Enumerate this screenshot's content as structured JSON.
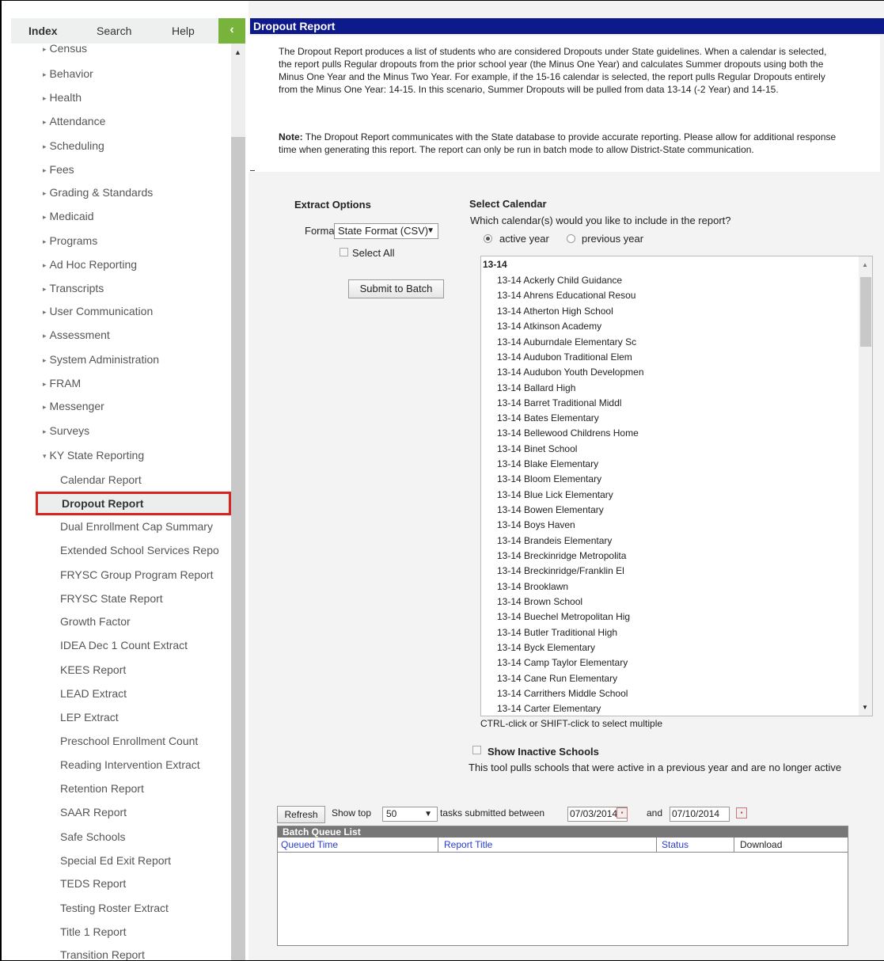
{
  "sidebar": {
    "tabs": {
      "index": "Index",
      "search": "Search",
      "help": "Help",
      "collapse": "‹"
    },
    "items": [
      "Census",
      "Behavior",
      "Health",
      "Attendance",
      "Scheduling",
      "Fees",
      "Grading & Standards",
      "Medicaid",
      "Programs",
      "Ad Hoc Reporting",
      "Transcripts",
      "User Communication",
      "Assessment",
      "System Administration",
      "FRAM",
      "Messenger",
      "Surveys"
    ],
    "expanded": "KY State Reporting",
    "subitems": [
      "Calendar Report",
      "Dropout Report",
      "Dual Enrollment Cap Summary",
      "Extended School Services Repo",
      "FRYSC Group Program Report",
      "FRYSC State Report",
      "Growth Factor",
      "IDEA Dec 1 Count Extract",
      "KEES Report",
      "LEAD Extract",
      "LEP Extract",
      "Preschool Enrollment Count",
      "Reading Intervention Extract",
      "Retention Report",
      "SAAR Report",
      "Safe Schools",
      "Special Ed Exit Report",
      "TEDS Report",
      "Testing Roster Extract",
      "Title 1 Report",
      "Transition Report"
    ],
    "selected": "Dropout Report"
  },
  "header": {
    "title": "Dropout Report"
  },
  "description": {
    "p1": "The Dropout Report produces a list of students who are considered Dropouts under State guidelines. When a calendar is selected, the report pulls Regular dropouts from the prior school year (the Minus One Year) and calculates Summer dropouts using both the Minus One Year and the Minus Two Year. For example, if the 15-16 calendar is selected, the report pulls Regular Dropouts entirely from the Minus One Year: 14-15. In this scenario, Summer Dropouts will be pulled from data 13-14 (-2 Year) and 14-15.",
    "note_label": "Note:",
    "note": " The Dropout Report communicates with the State database to provide accurate reporting. Please allow for additional response time when generating this report. The report can only be run in batch mode to allow District-State communication."
  },
  "extract": {
    "title": "Extract Options",
    "format_label": "Format",
    "format_value": "State Format (CSV)",
    "select_all": "Select All",
    "submit": "Submit to Batch"
  },
  "calendar": {
    "title": "Select Calendar",
    "question": "Which calendar(s) would you like to include in the report?",
    "radio_active": "active year",
    "radio_previous": "previous year",
    "group": "13-14",
    "options": [
      "13-14 Ackerly Child Guidance",
      "13-14 Ahrens Educational Resou",
      "13-14 Atherton High School",
      "13-14 Atkinson Academy",
      "13-14 Auburndale Elementary Sc",
      "13-14 Audubon Traditional Elem",
      "13-14 Audubon Youth Developmen",
      "13-14 Ballard High",
      "13-14 Barret Traditional Middl",
      "13-14 Bates Elementary",
      "13-14 Bellewood Childrens Home",
      "13-14 Binet School",
      "13-14 Blake Elementary",
      "13-14 Bloom Elementary",
      "13-14 Blue Lick Elementary",
      "13-14 Bowen Elementary",
      "13-14 Boys Haven",
      "13-14 Brandeis Elementary",
      "13-14 Breckinridge Metropolita",
      "13-14 Breckinridge/Franklin El",
      "13-14 Brooklawn",
      "13-14 Brown School",
      "13-14 Buechel Metropolitan Hig",
      "13-14 Butler Traditional High",
      "13-14 Byck Elementary",
      "13-14 Camp Taylor Elementary",
      "13-14 Cane Run Elementary",
      "13-14 Carrithers Middle School",
      "13-14 Carter Elementary"
    ],
    "hint": "CTRL-click or SHIFT-click to select multiple",
    "inactive_label": "Show Inactive Schools",
    "inactive_note": "This tool pulls schools that were active in a previous year and are no longer active"
  },
  "batch": {
    "refresh": "Refresh",
    "show_top": "Show top",
    "show_top_value": "50",
    "between": "tasks submitted between",
    "date_from": "07/03/2014",
    "and": "and",
    "date_to": "07/10/2014",
    "table_title": "Batch Queue List",
    "columns": [
      "Queued Time",
      "Report Title",
      "Status",
      "Download"
    ]
  }
}
